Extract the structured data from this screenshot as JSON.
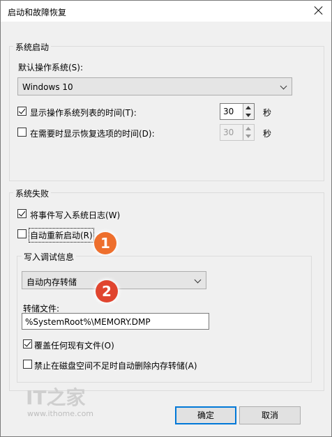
{
  "window": {
    "title": "启动和故障恢复"
  },
  "system_startup": {
    "group_label": "系统启动",
    "default_os_label": "默认操作系统(S):",
    "default_os_value": "Windows 10",
    "show_list_label": "显示操作系统列表的时间(T):",
    "show_list_checked": true,
    "show_list_seconds": "30",
    "show_recovery_label": "在需要时显示恢复选项的时间(D):",
    "show_recovery_checked": false,
    "show_recovery_seconds": "30",
    "seconds_unit": "秒"
  },
  "system_failure": {
    "group_label": "系统失败",
    "write_event_label": "将事件写入系统日志(W)",
    "write_event_checked": true,
    "auto_restart_label": "自动重新启动(R)",
    "auto_restart_checked": false,
    "debug_info": {
      "group_label": "写入调试信息",
      "dump_type_value": "自动内存转储",
      "dump_file_label": "转储文件:",
      "dump_file_value": "%SystemRoot%\\MEMORY.DMP",
      "overwrite_label": "覆盖任何现有文件(O)",
      "overwrite_checked": true,
      "disable_auto_delete_label": "禁止在磁盘空间不足时自动删除内存转储(A)",
      "disable_auto_delete_checked": false
    }
  },
  "annotations": {
    "badge1": "1",
    "badge2": "2"
  },
  "buttons": {
    "ok_label": "确定",
    "cancel_label": "取消"
  },
  "watermark": {
    "logo_text": "IT之家",
    "url": "www.ithome.com"
  },
  "colors": {
    "accent": "#0078d7",
    "badge_orange": "#ee6f2d",
    "badge_red": "#e0452f"
  }
}
